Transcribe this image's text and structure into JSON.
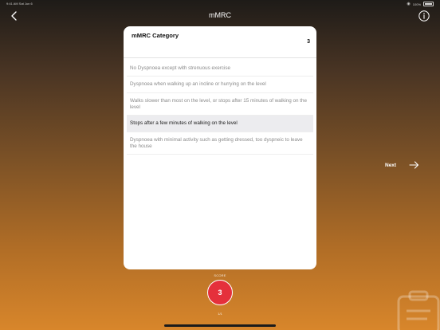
{
  "status_bar": {
    "time": "9:41 AM Sat Jun 6",
    "battery": "100%"
  },
  "header": {
    "title": "mMRC"
  },
  "card": {
    "title": "mMRC Category",
    "value": "3",
    "options": [
      {
        "label": "No Dyspnoea except with strenuous exercise",
        "selected": false
      },
      {
        "label": "Dyspnoea when walking up an incline or hurrying on the level",
        "selected": false
      },
      {
        "label": "Walks slower than most on the level, or stops after 15 minutes of walking on the level",
        "selected": false
      },
      {
        "label": "Stops after a few minutes of walking on the level",
        "selected": true
      },
      {
        "label": "Dyspnoea with minimal activity such as getting dressed, too dyspneic to leave the house",
        "selected": false
      }
    ]
  },
  "next": {
    "label": "Next"
  },
  "score": {
    "label": "SCORE",
    "value": "3"
  },
  "pager": {
    "text": "1/1"
  },
  "icons": {
    "back": "chevron-left-icon",
    "info": "info-icon",
    "next": "arrow-right-icon",
    "wifi": "wifi-icon",
    "battery": "battery-icon",
    "watermark": "clipboard-icon"
  },
  "colors": {
    "score": "#e5303b",
    "selected_row": "#ececef"
  }
}
